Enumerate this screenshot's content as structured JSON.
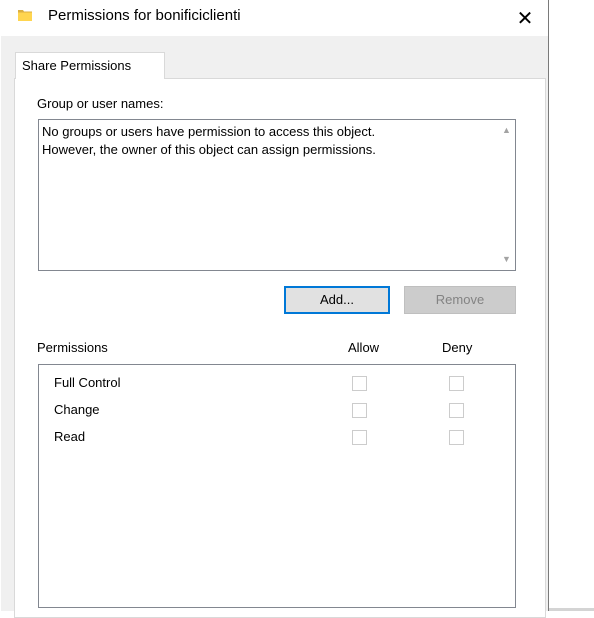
{
  "window": {
    "title": "Permissions for bonificiclienti",
    "close_symbol": "✕",
    "folder_icon": "folder-icon",
    "folder_color": "#ffd54f"
  },
  "tabs": [
    {
      "label": "Share Permissions",
      "active": true
    }
  ],
  "groups": {
    "label": "Group or user names:",
    "message_line1": "No groups or users have permission to access this object.",
    "message_line2": "However, the owner of this object can assign permissions.",
    "items": []
  },
  "buttons": {
    "add_label": "Add...",
    "remove_label": "Remove",
    "remove_disabled": true
  },
  "permissions": {
    "label": "Permissions",
    "allow_header": "Allow",
    "deny_header": "Deny",
    "rows": [
      {
        "name": "Full Control",
        "allow": false,
        "deny": false
      },
      {
        "name": "Change",
        "allow": false,
        "deny": false
      },
      {
        "name": "Read",
        "allow": false,
        "deny": false
      }
    ]
  },
  "colors": {
    "focus_border": "#0078d7",
    "dialog_bg": "#f0f0f0"
  }
}
